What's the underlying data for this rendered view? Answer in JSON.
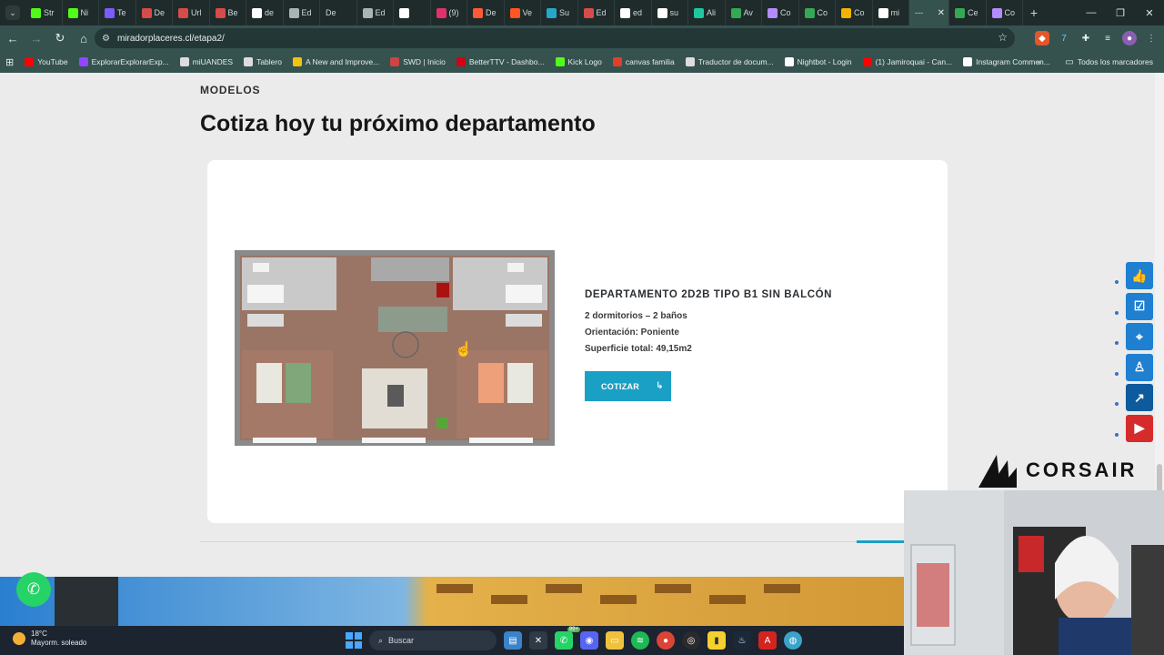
{
  "browser": {
    "tabs": [
      {
        "label": "Str",
        "icon": "kick-icon",
        "color": "#53fc18",
        "active": false
      },
      {
        "label": "Ni",
        "icon": "kick-icon",
        "color": "#53fc18",
        "active": false
      },
      {
        "label": "Te",
        "icon": "infinity-icon",
        "color": "#7b5cff",
        "active": false
      },
      {
        "label": "De",
        "icon": "link-icon",
        "color": "#d84b4b",
        "active": false
      },
      {
        "label": "Url",
        "icon": "link-icon",
        "color": "#d84b4b",
        "active": false
      },
      {
        "label": "Be",
        "icon": "link-icon",
        "color": "#d84b4b",
        "active": false
      },
      {
        "label": "de",
        "icon": "google-icon",
        "color": "#ffffff",
        "active": false
      },
      {
        "label": "Ed",
        "icon": "grid-icon",
        "color": "#aab4b4",
        "active": false
      },
      {
        "label": "De",
        "icon": "",
        "color": "",
        "active": false
      },
      {
        "label": "Ed",
        "icon": "grid-icon",
        "color": "#aab4b4",
        "active": false
      },
      {
        "label": "",
        "icon": "audio-icon",
        "color": "#ffffff",
        "active": false
      },
      {
        "label": "(9)",
        "icon": "instagram-icon",
        "color": "#e1306c",
        "active": false
      },
      {
        "label": "De",
        "icon": "p-icon",
        "color": "#ff5a36",
        "active": false
      },
      {
        "label": "Ve",
        "icon": "square-icon",
        "color": "#ff5722",
        "active": false
      },
      {
        "label": "Su",
        "icon": "wave-icon",
        "color": "#25a8c8",
        "active": false
      },
      {
        "label": "Ed",
        "icon": "wave-icon",
        "color": "#d84b4b",
        "active": false
      },
      {
        "label": "ed",
        "icon": "google-icon",
        "color": "#ffffff",
        "active": false
      },
      {
        "label": "su",
        "icon": "google-icon",
        "color": "#ffffff",
        "active": false
      },
      {
        "label": "Ali",
        "icon": "bar-icon",
        "color": "#1ec8a0",
        "active": false
      },
      {
        "label": "Av",
        "icon": "maps-icon",
        "color": "#34a853",
        "active": false
      },
      {
        "label": "Co",
        "icon": "feather-icon",
        "color": "#b48cff",
        "active": false
      },
      {
        "label": "Co",
        "icon": "maps-icon",
        "color": "#34a853",
        "active": false
      },
      {
        "label": "Co",
        "icon": "triangle-icon",
        "color": "#f4b400",
        "active": false
      },
      {
        "label": "mi",
        "icon": "google-icon",
        "color": "#ffffff",
        "active": false
      },
      {
        "label": "---",
        "icon": "",
        "color": "",
        "active": true
      },
      {
        "label": "Ce",
        "icon": "maps-icon",
        "color": "#34a853",
        "active": false
      },
      {
        "label": "Co",
        "icon": "feather-icon",
        "color": "#b48cff",
        "active": false
      }
    ],
    "url": "miradorplaceres.cl/etapa2/",
    "bookmarks": [
      {
        "label": "YouTube",
        "icon": "youtube-icon",
        "color": "#ff0000"
      },
      {
        "label": "ExplorarExplorarExp...",
        "icon": "twitch-icon",
        "color": "#9146ff"
      },
      {
        "label": "miUANDES",
        "icon": "uandes-icon",
        "color": "#dddddd"
      },
      {
        "label": "Tablero",
        "icon": "board-icon",
        "color": "#dddddd"
      },
      {
        "label": "A New and Improve...",
        "icon": "pin-icon",
        "color": "#f4c20d"
      },
      {
        "label": "SWD | Inicio",
        "icon": "swd-icon",
        "color": "#cc4444"
      },
      {
        "label": "BetterTTV - Dashbo...",
        "icon": "bttv-icon",
        "color": "#d50014"
      },
      {
        "label": "Kick Logo",
        "icon": "kick-icon",
        "color": "#53fc18"
      },
      {
        "label": "canvas familia",
        "icon": "canvas-icon",
        "color": "#e13f2b"
      },
      {
        "label": "Traductor de docum...",
        "icon": "translate-icon",
        "color": "#dddddd"
      },
      {
        "label": "Nightbot - Login",
        "icon": "nightbot-icon",
        "color": "#ffffff"
      },
      {
        "label": "(1) Jamiroquai - Can...",
        "icon": "youtube-icon",
        "color": "#ff0000"
      },
      {
        "label": "Instagram Commen...",
        "icon": "chat-icon",
        "color": "#ffffff"
      }
    ],
    "bookmarks_overflow": "»",
    "all_bookmarks": "Todos los marcadores"
  },
  "page": {
    "eyebrow": "MODELOS",
    "headline": "Cotiza hoy tu próximo departamento",
    "unit": {
      "title": "DEPARTAMENTO 2D2B TIPO B1 SIN BALCÓN",
      "specs": [
        "2 dormitorios – 2 baños",
        "Orientación: Poniente",
        "Superficie total: 49,15m2"
      ],
      "cta": "COTIZAR"
    },
    "side_buttons": [
      {
        "name": "like-icon",
        "color": "#1f7fd1"
      },
      {
        "name": "checklist-icon",
        "color": "#1f7fd1"
      },
      {
        "name": "map-pin-icon",
        "color": "#1f7fd1"
      },
      {
        "name": "person-icon",
        "color": "#1f7fd1"
      },
      {
        "name": "chart-icon",
        "color": "#0d5a9c"
      },
      {
        "name": "youtube-icon",
        "color": "#d62b2b"
      }
    ],
    "accent_color": "#1aa0c5"
  },
  "overlay": {
    "brand": "CORSAIR"
  },
  "taskbar": {
    "weather_temp": "18°C",
    "weather_desc": "Mayorm. soleado",
    "search_placeholder": "Buscar",
    "badge": "99+"
  }
}
